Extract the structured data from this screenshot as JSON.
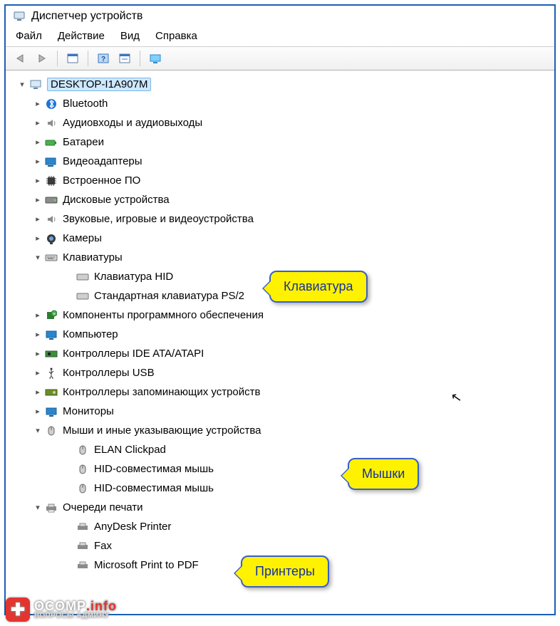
{
  "window": {
    "title": "Диспетчер устройств"
  },
  "menu": {
    "file": "Файл",
    "action": "Действие",
    "view": "Вид",
    "help": "Справка"
  },
  "root": "DESKTOP-I1A907M",
  "cats": {
    "bluetooth": "Bluetooth",
    "audio": "Аудиовходы и аудиовыходы",
    "battery": "Батареи",
    "video": "Видеоадаптеры",
    "firmware": "Встроенное ПО",
    "disk": "Дисковые устройства",
    "sound": "Звуковые, игровые и видеоустройства",
    "camera": "Камеры",
    "keyboard": "Клавиатуры",
    "softcomp": "Компоненты программного обеспечения",
    "computer": "Компьютер",
    "ide": "Контроллеры IDE ATA/ATAPI",
    "usb": "Контроллеры USB",
    "storage": "Контроллеры запоминающих устройств",
    "monitor": "Мониторы",
    "mice": "Мыши и иные указывающие устройства",
    "printq": "Очереди печати"
  },
  "kb": {
    "hid": "Клавиатура HID",
    "ps2": "Стандартная клавиатура PS/2"
  },
  "mouse": {
    "elan": "ELAN Clickpad",
    "hid1": "HID-совместимая мышь",
    "hid2": "HID-совместимая мышь"
  },
  "print": {
    "anydesk": "AnyDesk Printer",
    "fax": "Fax",
    "pdf": "Microsoft Print to PDF"
  },
  "callouts": {
    "kb": "Клавиатура",
    "mouse": "Мышки",
    "printer": "Принтеры"
  },
  "wm": {
    "brand": "OCOMP",
    "suffix": ".info",
    "sub": "ВОПРОСЫ АДМИНУ"
  }
}
